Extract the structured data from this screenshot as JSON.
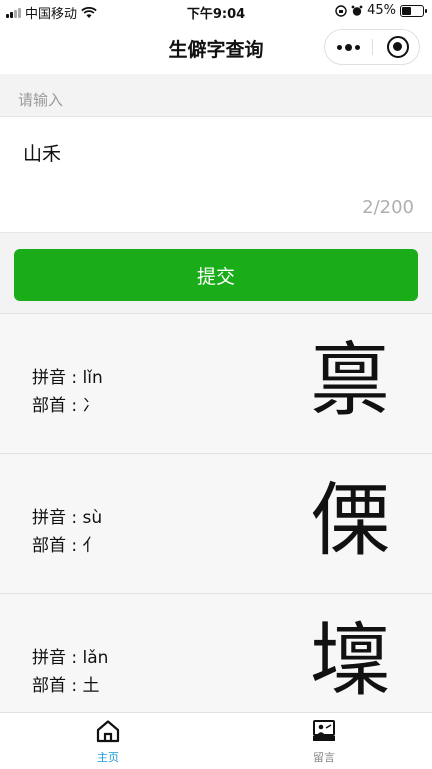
{
  "status_bar": {
    "carrier": "中国移动",
    "time": "下午9:04",
    "battery": "45%",
    "battery_level": 0.45
  },
  "header": {
    "title": "生僻字查询"
  },
  "form": {
    "label": "请输入",
    "value": "山禾",
    "counter": "2/200",
    "submit_label": "提交"
  },
  "results": [
    {
      "char": "禀",
      "pinyin_label": "拼音 : lǐn",
      "radical_label": "部首 : 冫"
    },
    {
      "char": "傈",
      "pinyin_label": "拼音 : sù",
      "radical_label": "部首 : 亻"
    },
    {
      "char": "壈",
      "pinyin_label": "拼音 : lǎn",
      "radical_label": "部首 : 土"
    }
  ],
  "tabbar": {
    "home_label": "主页",
    "message_label": "留言"
  },
  "colors": {
    "accent_green": "#1aad19",
    "tab_active": "#1a9bd7"
  }
}
